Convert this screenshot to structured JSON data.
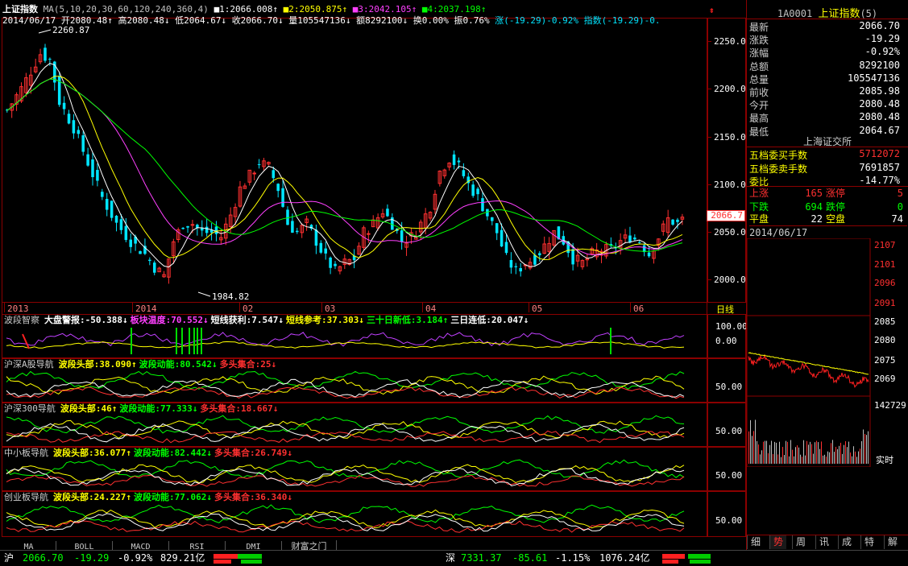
{
  "header": {
    "index_name": "上证指数",
    "ma_params": "MA(5,10,20,30,60,120,240,360,4)",
    "ma1": "■1:2066.008↑",
    "ma2": "■2:2050.875↑",
    "ma3": "■3:2042.105↑",
    "ma4": "■4:2037.198↑",
    "line2": {
      "date": "2014/06/17",
      "open": "开2080.48↑",
      "high": "高2080.48↓",
      "low": "低2064.67↓",
      "close": "收2066.70↓",
      "volume": "量105547136↓",
      "amount": "额8292100↓",
      "turnover": "换0.00%",
      "amplitude": "振0.76%",
      "change": "涨(-19.29)-0.92%",
      "index_chg": "指数(-19.29)-0."
    }
  },
  "main_chart": {
    "price_ticks": [
      "2250.0",
      "2200.0",
      "2150.0",
      "2100.0",
      "2050.0",
      "2000.0"
    ],
    "high_marker": "2260.87",
    "low_marker": "1984.82",
    "last_price_tag": "2066.7",
    "x_labels": [
      "2013",
      "2014",
      "02",
      "03",
      "04",
      "05",
      "06"
    ],
    "period": "日线"
  },
  "indicator_panels": [
    {
      "title": "波段智察",
      "items": [
        {
          "text": "大盘警报:-50.388↓",
          "color": "#ffffff"
        },
        {
          "text": "板块温度:70.552↓",
          "color": "#ff40ff"
        },
        {
          "text": "短线获利:7.547↓",
          "color": "#ffffff"
        },
        {
          "text": "短线参考:37.303↓",
          "color": "#ffff00"
        },
        {
          "text": "三十日新低:3.184↑",
          "color": "#00ff00"
        },
        {
          "text": "三日连低:20.047↓",
          "color": "#ffffff"
        }
      ],
      "ticks": [
        "100.00",
        "0.00"
      ]
    },
    {
      "title": "沪深A股导航",
      "items": [
        {
          "text": "波段头部:38.090↑",
          "color": "#ffff00"
        },
        {
          "text": "波段动能:80.542↓",
          "color": "#00ff00"
        },
        {
          "text": "多头集合:25↓",
          "color": "#ff3030"
        }
      ],
      "ticks": [
        "50.00"
      ]
    },
    {
      "title": "沪深300导航",
      "items": [
        {
          "text": "波段头部:46↑",
          "color": "#ffff00"
        },
        {
          "text": "波段动能:77.333↓",
          "color": "#00ff00"
        },
        {
          "text": "多头集合:18.667↓",
          "color": "#ff3030"
        }
      ],
      "ticks": [
        "50.00"
      ]
    },
    {
      "title": "中小板导航",
      "items": [
        {
          "text": "波段头部:36.077↑",
          "color": "#ffff00"
        },
        {
          "text": "波段动能:82.442↓",
          "color": "#00ff00"
        },
        {
          "text": "多头集合:26.749↓",
          "color": "#ff3030"
        }
      ],
      "ticks": [
        "50.00"
      ]
    },
    {
      "title": "创业板导航",
      "items": [
        {
          "text": "波段头部:24.227↑",
          "color": "#ffff00"
        },
        {
          "text": "波段动能:77.062↓",
          "color": "#00ff00"
        },
        {
          "text": "多头集合:36.340↓",
          "color": "#ff3030"
        }
      ],
      "ticks": [
        "50.00"
      ]
    }
  ],
  "bottom_tabs": [
    "MA",
    "BOLL",
    "MACD",
    "RSI",
    "DMI",
    "财富之门"
  ],
  "right_panel": {
    "code": "1A0001",
    "name": "上证指数",
    "count": "(5)",
    "quote": [
      {
        "k": "最新",
        "v": "2066.70",
        "c": "#ffffff"
      },
      {
        "k": "涨跌",
        "v": "-19.29",
        "c": "#ffffff"
      },
      {
        "k": "涨幅",
        "v": "-0.92%",
        "c": "#ffffff"
      },
      {
        "k": "总额",
        "v": "8292100",
        "c": "#ffffff"
      },
      {
        "k": "总量",
        "v": "105547136",
        "c": "#ffffff"
      },
      {
        "k": "前收",
        "v": "2085.98",
        "c": "#ffffff"
      },
      {
        "k": "今开",
        "v": "2080.48",
        "c": "#ffffff"
      },
      {
        "k": "最高",
        "v": "2080.48",
        "c": "#ffffff"
      },
      {
        "k": "最低",
        "v": "2064.67",
        "c": "#ffffff"
      }
    ],
    "exchange": "上海证交所",
    "orderbook": [
      {
        "k": "五档委买手数",
        "v": "5712072",
        "c": "#ff3030"
      },
      {
        "k": "五档委卖手数",
        "v": "7691857",
        "c": "#ffffff"
      },
      {
        "k": "委比",
        "v": "-14.77%",
        "c": "#ffffff"
      }
    ],
    "breadth": {
      "up_label": "上涨",
      "up": "165",
      "limit_up_label": "涨停",
      "limit_up": "5",
      "down_label": "下跌",
      "down": "694",
      "limit_down_label": "跌停",
      "limit_down": "0",
      "flat_label": "平盘",
      "flat": "22",
      "empty_label": "空盘",
      "empty": "74"
    },
    "mini_date": "2014/06/17",
    "mini_ticks_red": [
      "2107",
      "2101",
      "2096",
      "2091"
    ],
    "mini_ticks_white": [
      "2085",
      "2080",
      "2075",
      "2069"
    ],
    "volume_tick": "142729",
    "realtime_label": "实时",
    "tabs": [
      "细",
      "势",
      "周",
      "讯",
      "成",
      "特",
      "解"
    ]
  },
  "status_bar": {
    "sh_label": "沪",
    "sh_price": "2066.70",
    "sh_chg": "-19.29",
    "sh_pct": "-0.92%",
    "sh_amt": "829.21亿",
    "sz_label": "深",
    "sz_price": "7331.37",
    "sz_chg": "-85.61",
    "sz_pct": "-1.15%",
    "sz_amt": "1076.24亿"
  },
  "colors": {
    "up": "#ff3030",
    "down": "#00e5ff",
    "ma5": "#ffffff",
    "ma10": "#ffff00",
    "ma20": "#ff40ff",
    "ma30": "#00ff00",
    "frame": "#8b0000"
  },
  "icons": {
    "up_arrow": "up-arrow-icon",
    "menu": "red-menu-icon"
  }
}
